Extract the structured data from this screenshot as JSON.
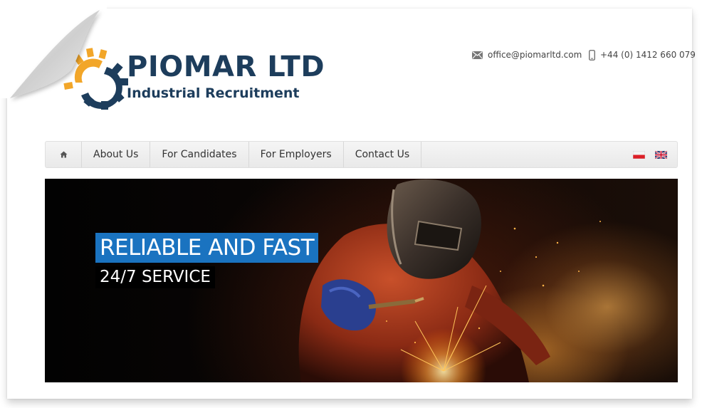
{
  "brand": {
    "name": "PIOMAR LTD",
    "tagline": "Industrial Recruitment",
    "colors": {
      "primary": "#1d3d5c",
      "accent": "#f2a629",
      "highlight": "#1a73c0"
    }
  },
  "contact": {
    "email": "office@piomarltd.com",
    "email_icon": "envelope-icon",
    "phone": "+44 (0) 1412 660 079",
    "phone_icon": "mobile-phone-icon"
  },
  "nav": {
    "home_icon": "home-icon",
    "items": [
      {
        "label": "About Us"
      },
      {
        "label": "For Candidates"
      },
      {
        "label": "For Employers"
      },
      {
        "label": "Contact Us"
      }
    ],
    "languages": [
      "polish-flag-icon",
      "uk-flag-icon"
    ]
  },
  "hero": {
    "headline": "RELIABLE AND FAST",
    "subline": "24/7 SERVICE"
  }
}
